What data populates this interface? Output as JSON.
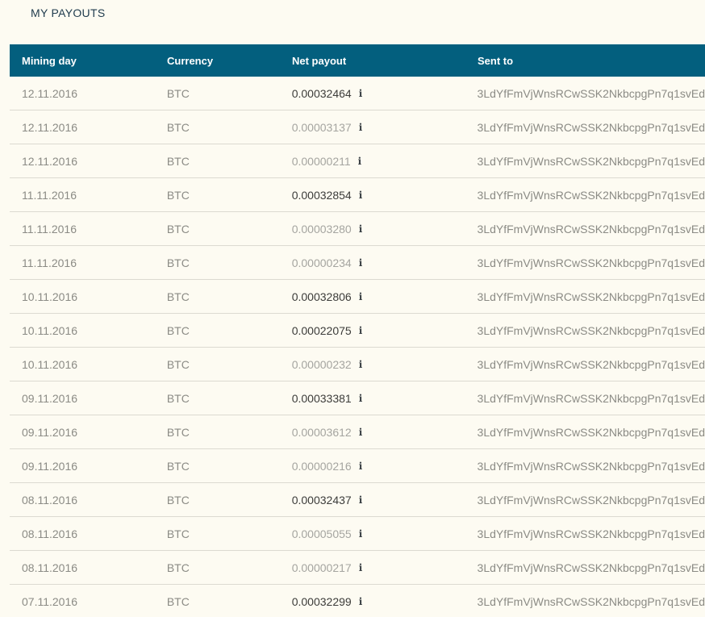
{
  "page": {
    "title": "MY PAYOUTS"
  },
  "table": {
    "headers": [
      "Mining day",
      "Currency",
      "Net payout",
      "Sent to"
    ],
    "info_glyph": "i",
    "rows": [
      {
        "day": "12.11.2016",
        "currency": "BTC",
        "net": "0.00032464",
        "major": true,
        "sent_to": "3LdYfFmVjWnsRCwSSK2NkbcpgPn7q1svEd"
      },
      {
        "day": "12.11.2016",
        "currency": "BTC",
        "net": "0.00003137",
        "major": false,
        "sent_to": "3LdYfFmVjWnsRCwSSK2NkbcpgPn7q1svEd"
      },
      {
        "day": "12.11.2016",
        "currency": "BTC",
        "net": "0.00000211",
        "major": false,
        "sent_to": "3LdYfFmVjWnsRCwSSK2NkbcpgPn7q1svEd"
      },
      {
        "day": "11.11.2016",
        "currency": "BTC",
        "net": "0.00032854",
        "major": true,
        "sent_to": "3LdYfFmVjWnsRCwSSK2NkbcpgPn7q1svEd"
      },
      {
        "day": "11.11.2016",
        "currency": "BTC",
        "net": "0.00003280",
        "major": false,
        "sent_to": "3LdYfFmVjWnsRCwSSK2NkbcpgPn7q1svEd"
      },
      {
        "day": "11.11.2016",
        "currency": "BTC",
        "net": "0.00000234",
        "major": false,
        "sent_to": "3LdYfFmVjWnsRCwSSK2NkbcpgPn7q1svEd"
      },
      {
        "day": "10.11.2016",
        "currency": "BTC",
        "net": "0.00032806",
        "major": true,
        "sent_to": "3LdYfFmVjWnsRCwSSK2NkbcpgPn7q1svEd"
      },
      {
        "day": "10.11.2016",
        "currency": "BTC",
        "net": "0.00022075",
        "major": true,
        "sent_to": "3LdYfFmVjWnsRCwSSK2NkbcpgPn7q1svEd"
      },
      {
        "day": "10.11.2016",
        "currency": "BTC",
        "net": "0.00000232",
        "major": false,
        "sent_to": "3LdYfFmVjWnsRCwSSK2NkbcpgPn7q1svEd"
      },
      {
        "day": "09.11.2016",
        "currency": "BTC",
        "net": "0.00033381",
        "major": true,
        "sent_to": "3LdYfFmVjWnsRCwSSK2NkbcpgPn7q1svEd"
      },
      {
        "day": "09.11.2016",
        "currency": "BTC",
        "net": "0.00003612",
        "major": false,
        "sent_to": "3LdYfFmVjWnsRCwSSK2NkbcpgPn7q1svEd"
      },
      {
        "day": "09.11.2016",
        "currency": "BTC",
        "net": "0.00000216",
        "major": false,
        "sent_to": "3LdYfFmVjWnsRCwSSK2NkbcpgPn7q1svEd"
      },
      {
        "day": "08.11.2016",
        "currency": "BTC",
        "net": "0.00032437",
        "major": true,
        "sent_to": "3LdYfFmVjWnsRCwSSK2NkbcpgPn7q1svEd"
      },
      {
        "day": "08.11.2016",
        "currency": "BTC",
        "net": "0.00005055",
        "major": false,
        "sent_to": "3LdYfFmVjWnsRCwSSK2NkbcpgPn7q1svEd"
      },
      {
        "day": "08.11.2016",
        "currency": "BTC",
        "net": "0.00000217",
        "major": false,
        "sent_to": "3LdYfFmVjWnsRCwSSK2NkbcpgPn7q1svEd"
      },
      {
        "day": "07.11.2016",
        "currency": "BTC",
        "net": "0.00032299",
        "major": true,
        "sent_to": "3LdYfFmVjWnsRCwSSK2NkbcpgPn7q1svEd"
      }
    ]
  },
  "colors": {
    "header_bg": "#035f7e",
    "page_bg": "#fdfbf2",
    "major_text": "#3c3c3a",
    "minor_text": "#a5a5a0"
  }
}
